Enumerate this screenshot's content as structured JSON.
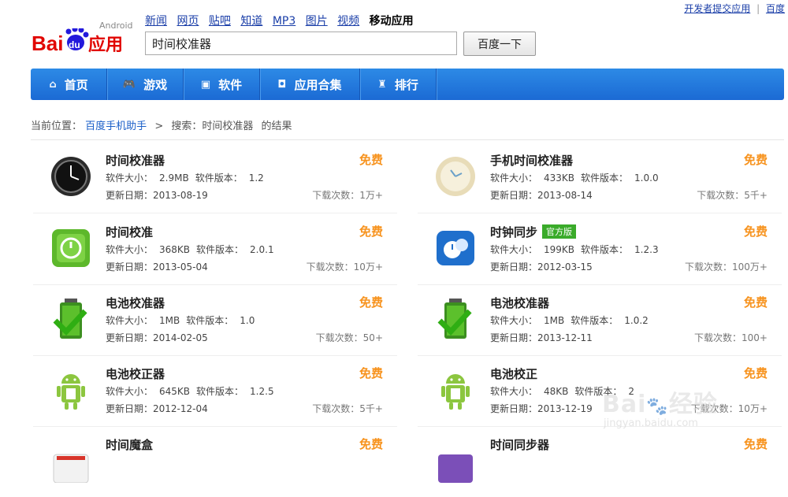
{
  "top_links": {
    "dev": "开发者提交应用",
    "sep": "|",
    "more": "百度"
  },
  "logo": {
    "android": "Android",
    "baidu_a": "Bai",
    "baidu_b": "du",
    "baidu_c": "应用"
  },
  "nav": [
    "新闻",
    "网页",
    "贴吧",
    "知道",
    "MP3",
    "图片",
    "视频"
  ],
  "nav_current": "移动应用",
  "search": {
    "value": "时间校准器",
    "button": "百度一下"
  },
  "menu": [
    {
      "label": "首页",
      "icon": "⌂"
    },
    {
      "label": "游戏",
      "icon": "🎮"
    },
    {
      "label": "软件",
      "icon": "▣"
    },
    {
      "label": "应用合集",
      "icon": "◘"
    },
    {
      "label": "排行",
      "icon": "♜"
    }
  ],
  "breadcrumb": {
    "prefix": "当前位置：",
    "link": "百度手机助手",
    "arrow": ">",
    "search_text": "搜索：时间校准器",
    "suffix": "的结果"
  },
  "apps": [
    {
      "name": "时间校准器",
      "price": "免费",
      "size_label": "软件大小：",
      "size": "2.9MB",
      "ver_label": "软件版本：",
      "version": "1.2",
      "date_label": "更新日期：",
      "date": "2013-08-19",
      "dl_label": "下载次数：",
      "downloads": "1万+",
      "icon": "clock-black-icon"
    },
    {
      "name": "手机时间校准器",
      "price": "免费",
      "size_label": "软件大小：",
      "size": "433KB",
      "ver_label": "软件版本：",
      "version": "1.0.0",
      "date_label": "更新日期：",
      "date": "2013-08-14",
      "dl_label": "下载次数：",
      "downloads": "5千+",
      "icon": "clock-cream-icon"
    },
    {
      "name": "时间校准",
      "price": "免费",
      "size_label": "软件大小：",
      "size": "368KB",
      "ver_label": "软件版本：",
      "version": "2.0.1",
      "date_label": "更新日期：",
      "date": "2013-05-04",
      "dl_label": "下载次数：",
      "downloads": "10万+",
      "icon": "clock-green-icon"
    },
    {
      "name": "时钟同步",
      "badge": "官方版",
      "price": "免费",
      "size_label": "软件大小：",
      "size": "199KB",
      "ver_label": "软件版本：",
      "version": "1.2.3",
      "date_label": "更新日期：",
      "date": "2012-03-15",
      "dl_label": "下载次数：",
      "downloads": "100万+",
      "icon": "clock-blue-icon"
    },
    {
      "name": "电池校准器",
      "price": "免费",
      "size_label": "软件大小：",
      "size": "1MB",
      "ver_label": "软件版本：",
      "version": "1.0",
      "date_label": "更新日期：",
      "date": "2014-02-05",
      "dl_label": "下载次数：",
      "downloads": "50+",
      "icon": "battery-check-icon"
    },
    {
      "name": "电池校准器",
      "price": "免费",
      "size_label": "软件大小：",
      "size": "1MB",
      "ver_label": "软件版本：",
      "version": "1.0.2",
      "date_label": "更新日期：",
      "date": "2013-12-11",
      "dl_label": "下载次数：",
      "downloads": "100+",
      "icon": "battery-check-icon"
    },
    {
      "name": "电池校正器",
      "price": "免费",
      "size_label": "软件大小：",
      "size": "645KB",
      "ver_label": "软件版本：",
      "version": "1.2.5",
      "date_label": "更新日期：",
      "date": "2012-12-04",
      "dl_label": "下载次数：",
      "downloads": "5千+",
      "icon": "android-battery-icon"
    },
    {
      "name": "电池校正",
      "price": "免费",
      "size_label": "软件大小：",
      "size": "48KB",
      "ver_label": "软件版本：",
      "version": "2",
      "date_label": "更新日期：",
      "date": "2013-12-19",
      "dl_label": "下载次数：",
      "downloads": "10万+",
      "icon": "android-battery-icon"
    },
    {
      "name": "时间魔盒",
      "price": "免费",
      "icon": "red-app-icon"
    },
    {
      "name": "时间同步器",
      "price": "免费",
      "icon": "purple-app-icon"
    }
  ],
  "watermark": {
    "text": "Bai",
    "brand": "经验",
    "url": "jingyan.baidu.com"
  },
  "colors": {
    "accent": "#1b6ad4",
    "price": "#f7931e",
    "badge": "#3aab2a",
    "logo_red": "#e10601",
    "logo_blue": "#2319dc"
  }
}
